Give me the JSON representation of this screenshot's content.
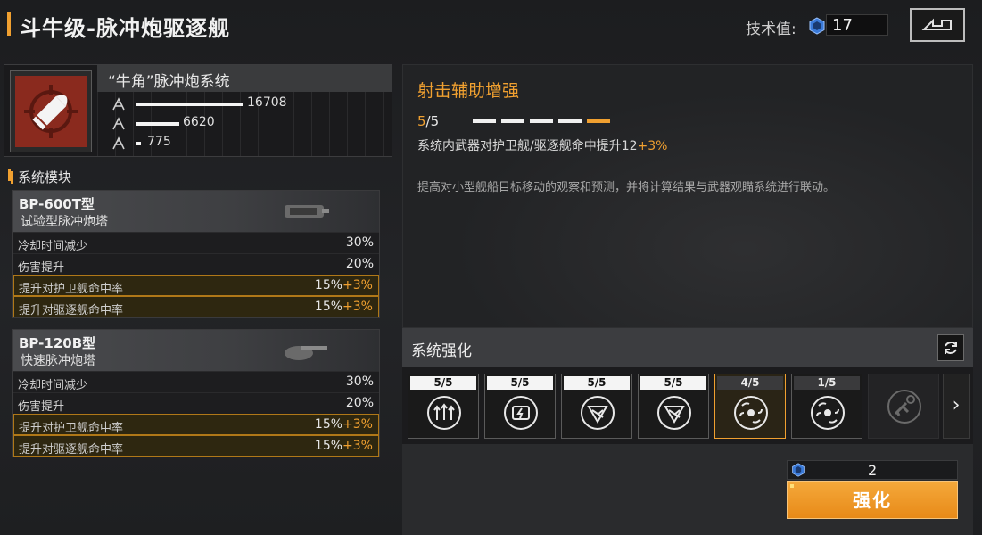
{
  "header": {
    "title": "斗牛级-脉冲炮驱逐舰",
    "tech_label": "技术值:",
    "tech_value": "17",
    "back_icon": "back-arrow-icon"
  },
  "weapon_system": {
    "name": "“牛角”脉冲炮系统",
    "icon": "bullet-crosshair-icon",
    "stats": [
      {
        "icon": "damage-icon",
        "value": "16708",
        "fill": 0.7
      },
      {
        "icon": "speed-icon",
        "value": "6620",
        "fill": 0.28
      },
      {
        "icon": "range-icon",
        "value": "775",
        "fill": 0.03
      }
    ]
  },
  "modules": {
    "section_title": "系统模块",
    "items": [
      {
        "code": "BP-600T型",
        "name": "试验型脉冲炮塔",
        "rows": [
          {
            "label": "冷却时间减少",
            "value": "30%",
            "bonus": ""
          },
          {
            "label": "伤害提升",
            "value": "20%",
            "bonus": ""
          },
          {
            "label": "提升对护卫舰命中率",
            "value": "15%",
            "bonus": "+3%"
          },
          {
            "label": "提升对驱逐舰命中率",
            "value": "15%",
            "bonus": "+3%"
          }
        ]
      },
      {
        "code": "BP-120B型",
        "name": "快速脉冲炮塔",
        "rows": [
          {
            "label": "冷却时间减少",
            "value": "30%",
            "bonus": ""
          },
          {
            "label": "伤害提升",
            "value": "20%",
            "bonus": ""
          },
          {
            "label": "提升对护卫舰命中率",
            "value": "15%",
            "bonus": "+3%"
          },
          {
            "label": "提升对驱逐舰命中率",
            "value": "15%",
            "bonus": "+3%"
          }
        ]
      }
    ]
  },
  "skill": {
    "title": "射击辅助增强",
    "level_current": "5",
    "level_sep": "/5",
    "pips_filled": 5,
    "effect_text": "系统内武器对护卫舰/驱逐舰命中提升12",
    "effect_bonus": "+3%",
    "description": "提高对小型舰船目标移动的观察和预测，并将计算结果与武器观瞄系统进行联动。"
  },
  "enhance": {
    "title": "系统强化",
    "refresh_icon": "refresh-icon",
    "slots": [
      {
        "level": "5/5",
        "icon": "triple-arrow-up-icon"
      },
      {
        "level": "5/5",
        "icon": "lightning-card-icon"
      },
      {
        "level": "5/5",
        "icon": "shield-cross-icon"
      },
      {
        "level": "5/5",
        "icon": "shield-cross-icon"
      },
      {
        "level": "4/5",
        "icon": "target-assist-icon"
      },
      {
        "level": "1/5",
        "icon": "target-assist-icon"
      },
      {
        "level": "",
        "icon": "locked-turret-icon"
      }
    ],
    "next_label": "›",
    "cost_value": "2",
    "button_label": "强化"
  },
  "colors": {
    "accent": "#f0a030",
    "panel": "#222325"
  }
}
